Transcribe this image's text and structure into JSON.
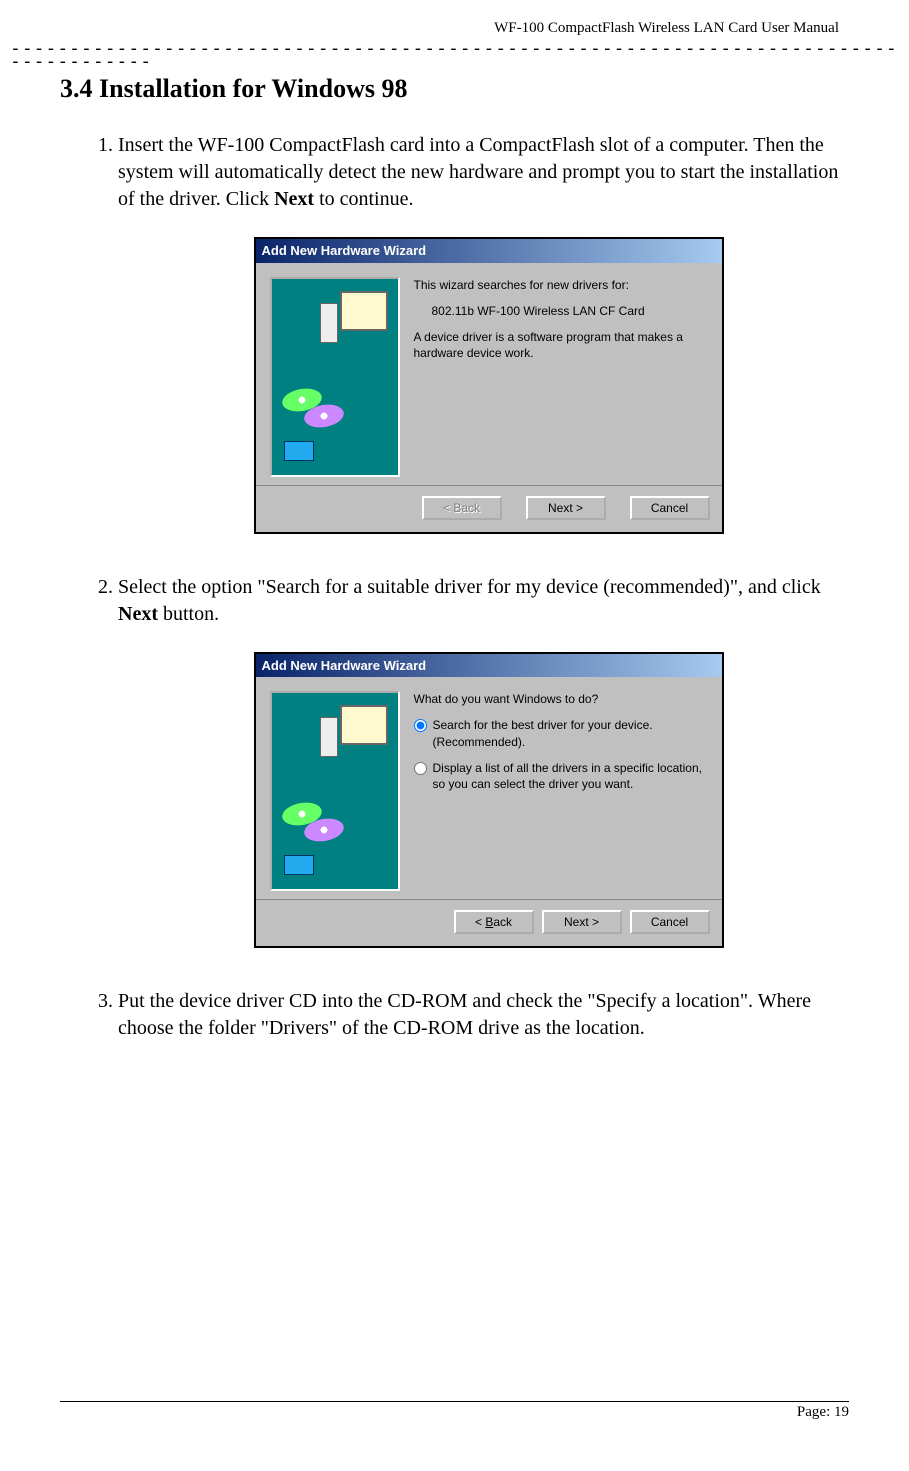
{
  "running_head": "WF-100 CompactFlash Wireless LAN Card User Manual",
  "divider": "---------------------------------------------------------------------------------------",
  "section_title": "3.4 Installation for Windows 98",
  "step1": {
    "pre": "Insert the WF-100 CompactFlash card into a CompactFlash slot of a computer. Then the system will automatically detect the new hardware and prompt you to start the installation of the driver. Click ",
    "bold": "Next",
    "post": " to continue."
  },
  "wizard1": {
    "title": "Add New Hardware Wizard",
    "line1": "This wizard searches for new drivers for:",
    "device": "802.11b WF-100 Wireless LAN CF Card",
    "line2": "A device driver is a software program that makes a hardware device work.",
    "btn_back": "< Back",
    "btn_next": "Next >",
    "btn_cancel": "Cancel"
  },
  "step2": {
    "pre": "Select the option \"Search for a suitable driver for my device (recommended)\", and click ",
    "bold": "Next",
    "post": " button."
  },
  "wizard2": {
    "title": "Add New Hardware Wizard",
    "question": "What do you want Windows to do?",
    "opt1": "Search for the best driver for your device. (Recommended).",
    "opt2": "Display a list of all the drivers in a specific location, so you can select the driver you want.",
    "btn_back_pre": "< ",
    "btn_back_u": "B",
    "btn_back_post": "ack",
    "btn_next": "Next >",
    "btn_cancel": "Cancel"
  },
  "step3": "Put the device driver CD into the CD-ROM and check the \"Specify a location\". Where choose the folder \"Drivers\" of the CD-ROM drive as the location.",
  "page_number": "Page: 19"
}
